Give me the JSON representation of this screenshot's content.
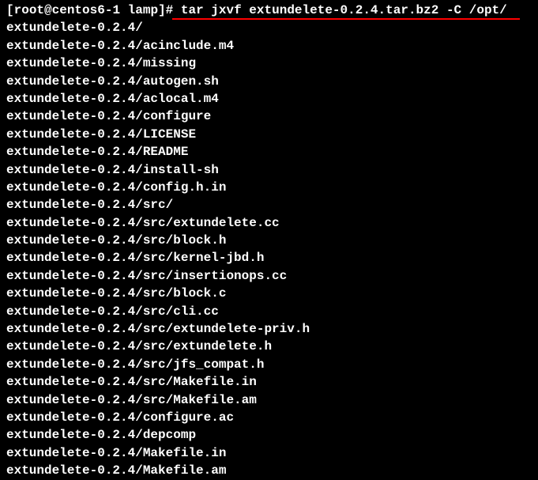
{
  "prompt": {
    "user": "root",
    "host": "centos6-1",
    "directory": "lamp",
    "symbol": "#",
    "command": "tar jxvf extundelete-0.2.4.tar.bz2 -C /opt/"
  },
  "output_lines": [
    "extundelete-0.2.4/",
    "extundelete-0.2.4/acinclude.m4",
    "extundelete-0.2.4/missing",
    "extundelete-0.2.4/autogen.sh",
    "extundelete-0.2.4/aclocal.m4",
    "extundelete-0.2.4/configure",
    "extundelete-0.2.4/LICENSE",
    "extundelete-0.2.4/README",
    "extundelete-0.2.4/install-sh",
    "extundelete-0.2.4/config.h.in",
    "extundelete-0.2.4/src/",
    "extundelete-0.2.4/src/extundelete.cc",
    "extundelete-0.2.4/src/block.h",
    "extundelete-0.2.4/src/kernel-jbd.h",
    "extundelete-0.2.4/src/insertionops.cc",
    "extundelete-0.2.4/src/block.c",
    "extundelete-0.2.4/src/cli.cc",
    "extundelete-0.2.4/src/extundelete-priv.h",
    "extundelete-0.2.4/src/extundelete.h",
    "extundelete-0.2.4/src/jfs_compat.h",
    "extundelete-0.2.4/src/Makefile.in",
    "extundelete-0.2.4/src/Makefile.am",
    "extundelete-0.2.4/configure.ac",
    "extundelete-0.2.4/depcomp",
    "extundelete-0.2.4/Makefile.in",
    "extundelete-0.2.4/Makefile.am"
  ]
}
